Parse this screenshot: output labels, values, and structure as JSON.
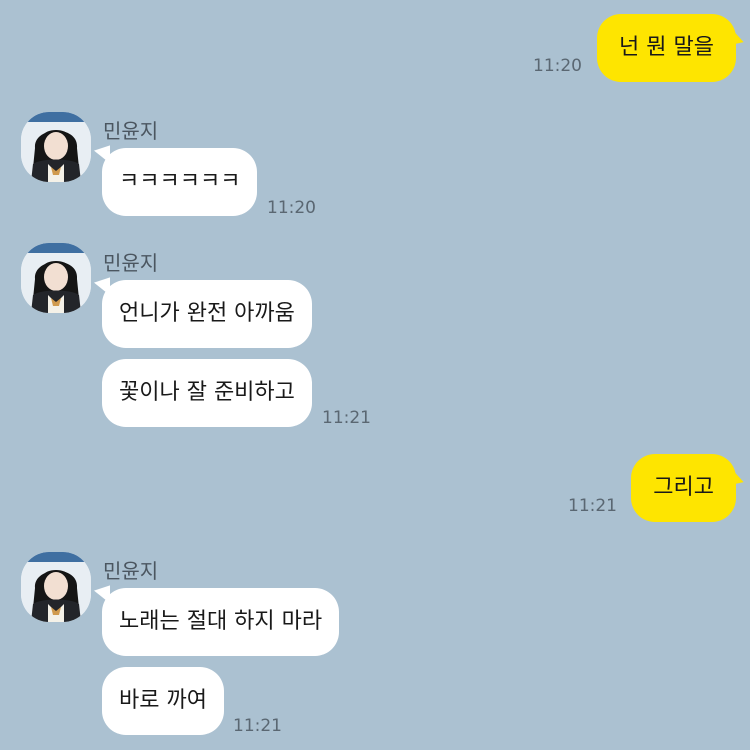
{
  "chat": {
    "outgoing": [
      {
        "text": "넌 뭔 말을",
        "time": "11:20"
      },
      {
        "text": "그리고",
        "time": "11:21"
      }
    ],
    "groups": [
      {
        "sender": "민윤지",
        "messages": [
          "ㅋㅋㅋㅋㅋㅋ"
        ],
        "time": "11:20"
      },
      {
        "sender": "민윤지",
        "messages": [
          "언니가 완전 아까움",
          "꽃이나 잘 준비하고"
        ],
        "time": "11:21"
      },
      {
        "sender": "민윤지",
        "messages": [
          "노래는 절대 하지 마라",
          "바로 까여"
        ],
        "time": "11:21"
      }
    ]
  },
  "colors": {
    "background": "#abc1d1",
    "outgoing_bubble": "#fee500",
    "incoming_bubble": "#ffffff"
  },
  "icons": {
    "avatar": "profile-photo-icon"
  }
}
